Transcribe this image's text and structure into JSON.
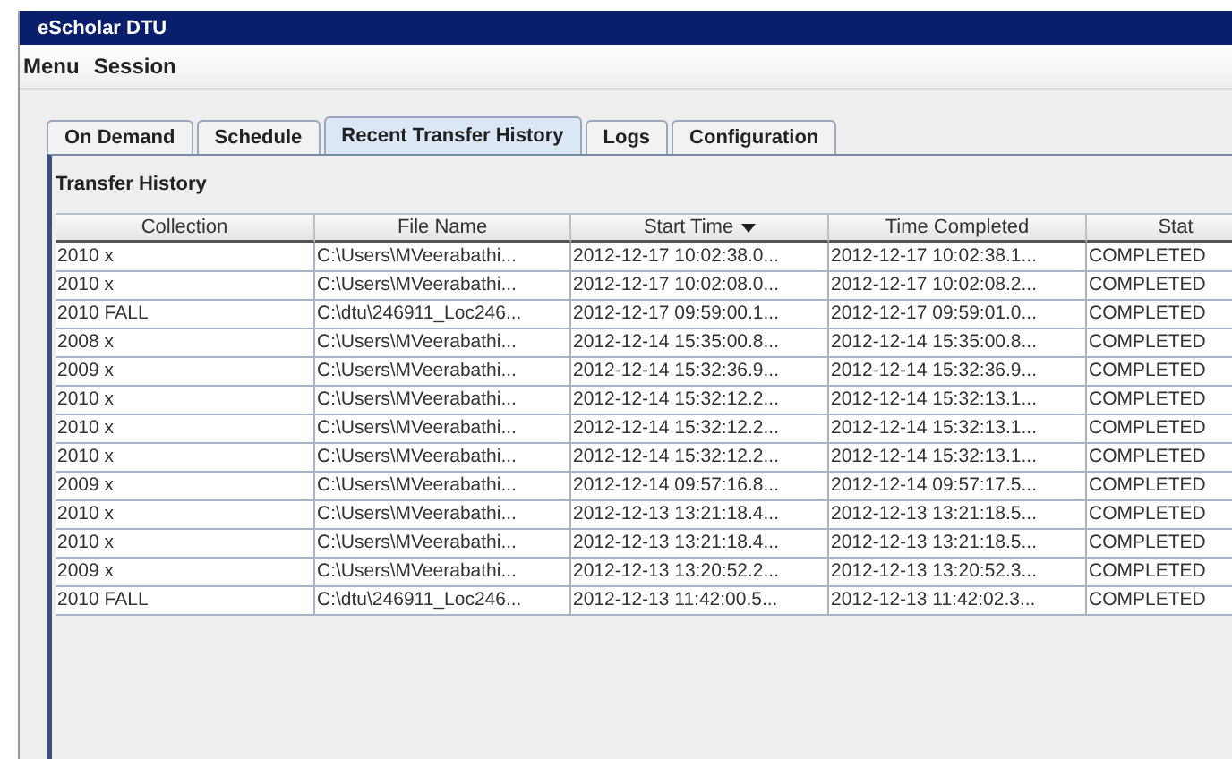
{
  "window": {
    "title": "eScholar DTU"
  },
  "menu": [
    "Menu",
    "Session"
  ],
  "tabs": [
    {
      "label": "On Demand",
      "selected": false
    },
    {
      "label": "Schedule",
      "selected": false
    },
    {
      "label": "Recent Transfer History",
      "selected": true
    },
    {
      "label": "Logs",
      "selected": false
    },
    {
      "label": "Configuration",
      "selected": false
    }
  ],
  "panel_title": "Transfer History",
  "table": {
    "columns": [
      {
        "label": "Collection",
        "sorted": false
      },
      {
        "label": "File Name",
        "sorted": false
      },
      {
        "label": "Start Time",
        "sorted": true
      },
      {
        "label": "Time Completed",
        "sorted": false
      },
      {
        "label": "Stat",
        "sorted": false
      }
    ],
    "rows": [
      [
        "2010 x",
        "C:\\Users\\MVeerabathi...",
        "2012-12-17 10:02:38.0...",
        "2012-12-17 10:02:38.1...",
        "COMPLETED"
      ],
      [
        "2010 x",
        "C:\\Users\\MVeerabathi...",
        "2012-12-17 10:02:08.0...",
        "2012-12-17 10:02:08.2...",
        "COMPLETED"
      ],
      [
        "2010 FALL",
        "C:\\dtu\\246911_Loc246...",
        "2012-12-17 09:59:00.1...",
        "2012-12-17 09:59:01.0...",
        "COMPLETED"
      ],
      [
        "2008 x",
        "C:\\Users\\MVeerabathi...",
        "2012-12-14 15:35:00.8...",
        "2012-12-14 15:35:00.8...",
        "COMPLETED"
      ],
      [
        "2009 x",
        "C:\\Users\\MVeerabathi...",
        "2012-12-14 15:32:36.9...",
        "2012-12-14 15:32:36.9...",
        "COMPLETED"
      ],
      [
        "2010 x",
        "C:\\Users\\MVeerabathi...",
        "2012-12-14 15:32:12.2...",
        "2012-12-14 15:32:13.1...",
        "COMPLETED"
      ],
      [
        "2010 x",
        "C:\\Users\\MVeerabathi...",
        "2012-12-14 15:32:12.2...",
        "2012-12-14 15:32:13.1...",
        "COMPLETED"
      ],
      [
        "2010 x",
        "C:\\Users\\MVeerabathi...",
        "2012-12-14 15:32:12.2...",
        "2012-12-14 15:32:13.1...",
        "COMPLETED"
      ],
      [
        "2009 x",
        "C:\\Users\\MVeerabathi...",
        "2012-12-14 09:57:16.8...",
        "2012-12-14 09:57:17.5...",
        "COMPLETED"
      ],
      [
        "2010 x",
        "C:\\Users\\MVeerabathi...",
        "2012-12-13 13:21:18.4...",
        "2012-12-13 13:21:18.5...",
        "COMPLETED"
      ],
      [
        "2010 x",
        "C:\\Users\\MVeerabathi...",
        "2012-12-13 13:21:18.4...",
        "2012-12-13 13:21:18.5...",
        "COMPLETED"
      ],
      [
        "2009 x",
        "C:\\Users\\MVeerabathi...",
        "2012-12-13 13:20:52.2...",
        "2012-12-13 13:20:52.3...",
        "COMPLETED"
      ],
      [
        "2010 FALL",
        "C:\\dtu\\246911_Loc246...",
        "2012-12-13 11:42:00.5...",
        "2012-12-13 11:42:02.3...",
        "COMPLETED"
      ]
    ]
  }
}
